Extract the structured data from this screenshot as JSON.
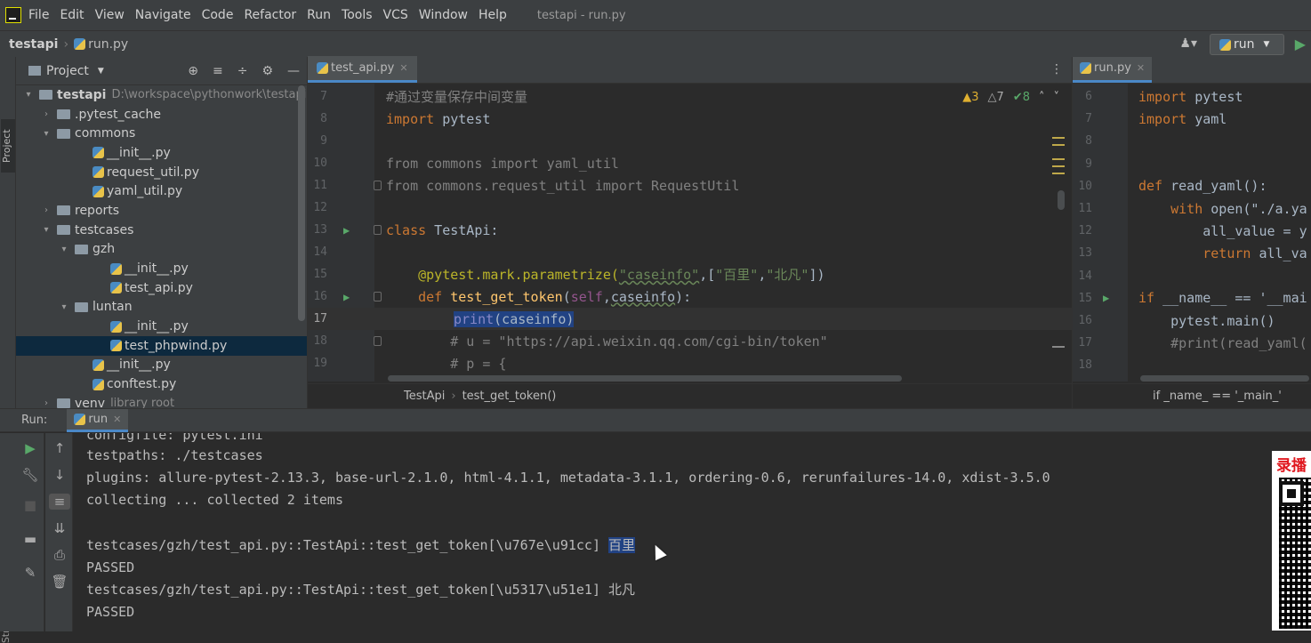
{
  "menubar": {
    "items": [
      "File",
      "Edit",
      "View",
      "Navigate",
      "Code",
      "Refactor",
      "Run",
      "Tools",
      "VCS",
      "Window",
      "Help"
    ],
    "window_title": "testapi - run.py"
  },
  "navbar": {
    "project": "testapi",
    "file": "run.py",
    "run_config": "run"
  },
  "left_stripe": {
    "project_label": "Project",
    "structure_label": "Structure"
  },
  "project_panel": {
    "title": "Project",
    "rows": [
      {
        "label": "testapi",
        "hint": "D:\\workspace\\pythonwork\\testapi",
        "type": "folder",
        "arrow": "▾",
        "indent": 0,
        "bold": true
      },
      {
        "label": ".pytest_cache",
        "type": "folder",
        "arrow": "›",
        "indent": 1
      },
      {
        "label": "commons",
        "type": "folder",
        "arrow": "▾",
        "indent": 1
      },
      {
        "label": "__init__.py",
        "type": "py",
        "arrow": "",
        "indent": 3
      },
      {
        "label": "request_util.py",
        "type": "py",
        "arrow": "",
        "indent": 3
      },
      {
        "label": "yaml_util.py",
        "type": "py",
        "arrow": "",
        "indent": 3
      },
      {
        "label": "reports",
        "type": "folder",
        "arrow": "›",
        "indent": 1
      },
      {
        "label": "testcases",
        "type": "folder",
        "arrow": "▾",
        "indent": 1
      },
      {
        "label": "gzh",
        "type": "folder",
        "arrow": "▾",
        "indent": 2
      },
      {
        "label": "__init__.py",
        "type": "py",
        "arrow": "",
        "indent": 4
      },
      {
        "label": "test_api.py",
        "type": "py",
        "arrow": "",
        "indent": 4
      },
      {
        "label": "luntan",
        "type": "folder",
        "arrow": "▾",
        "indent": 2
      },
      {
        "label": "__init__.py",
        "type": "py",
        "arrow": "",
        "indent": 4
      },
      {
        "label": "test_phpwind.py",
        "type": "py",
        "arrow": "",
        "indent": 4,
        "selected": true
      },
      {
        "label": "__init__.py",
        "type": "py",
        "arrow": "",
        "indent": 3
      },
      {
        "label": "conftest.py",
        "type": "py",
        "arrow": "",
        "indent": 3
      },
      {
        "label": "venv",
        "hint": "library root",
        "type": "folder",
        "arrow": "›",
        "indent": 1
      }
    ]
  },
  "left_editor": {
    "tab": "test_api.py",
    "inspections": {
      "warnings": "3",
      "weak": "7",
      "ok": "8"
    },
    "lines": [
      {
        "n": "7"
      },
      {
        "n": "8"
      },
      {
        "n": "9"
      },
      {
        "n": "10"
      },
      {
        "n": "11"
      },
      {
        "n": "12"
      },
      {
        "n": "13"
      },
      {
        "n": "14"
      },
      {
        "n": "15"
      },
      {
        "n": "16"
      },
      {
        "n": "17"
      },
      {
        "n": "18"
      },
      {
        "n": "19"
      }
    ],
    "code": {
      "l7": "#通过变量保存中间变量",
      "l8a": "import",
      "l8b": " pytest",
      "l10a": "from",
      "l10b": " commons ",
      "l10c": "import",
      "l10d": " yaml_util",
      "l11a": "from",
      "l11b": " commons.request_util ",
      "l11c": "import",
      "l11d": " RequestUtil",
      "l13a": "class",
      "l13b": " TestApi:",
      "l15a": "    @pytest.mark.parametrize(",
      "l15b": "\"caseinfo\"",
      "l15c": ",[",
      "l15d": "\"百里\"",
      "l15e": ",",
      "l15f": "\"北凡\"",
      "l15g": "])",
      "l16a": "    def ",
      "l16b": "test_get_token",
      "l16c": "(",
      "l16d": "self",
      "l16e": ",",
      "l16f": "caseinfo",
      "l16g": "):",
      "l17a": "print",
      "l17b": "(caseinfo)",
      "l18": "        # u = \"https://api.weixin.qq.com/cgi-bin/token\"",
      "l19": "        # p = {"
    },
    "breadcrumb": [
      "TestApi",
      "test_get_token()"
    ]
  },
  "right_editor": {
    "tab": "run.py",
    "lines": [
      {
        "n": "6",
        "code": "import pytest"
      },
      {
        "n": "7",
        "code": "import yaml"
      },
      {
        "n": "8",
        "code": ""
      },
      {
        "n": "9",
        "code": ""
      },
      {
        "n": "10",
        "code": "def read_yaml():"
      },
      {
        "n": "11",
        "code": "    with open(\"./a.ya"
      },
      {
        "n": "12",
        "code": "        all_value = y"
      },
      {
        "n": "13",
        "code": "        return all_va"
      },
      {
        "n": "14",
        "code": ""
      },
      {
        "n": "15",
        "code": "if __name__ == '__mai"
      },
      {
        "n": "16",
        "code": "    pytest.main()"
      },
      {
        "n": "17",
        "code": "    #print(read_yaml("
      },
      {
        "n": "18",
        "code": ""
      }
    ],
    "breadcrumb": "if _name_ == '_main_'"
  },
  "run_panel": {
    "label": "Run:",
    "tab": "run",
    "console": [
      "configfile: pytest.ini",
      "testpaths: ./testcases",
      "plugins: allure-pytest-2.13.3, base-url-2.1.0, html-4.1.1, metadata-3.1.1, ordering-0.6, rerunfailures-14.0, xdist-3.5.0",
      "collecting ... collected 2 items",
      "",
      "testcases/gzh/test_api.py::TestApi::test_get_token[\\u767e\\u91cc] ",
      "PASSED",
      "testcases/gzh/test_api.py::TestApi::test_get_token[\\u5317\\u51e1] 北凡",
      "PASSED"
    ],
    "selected_text": "百里"
  },
  "overlay": {
    "text": "录播"
  },
  "colors": {
    "accent": "#4a88c7",
    "run_green": "#59a869",
    "selection": "#214283",
    "warning": "#e0b030"
  }
}
